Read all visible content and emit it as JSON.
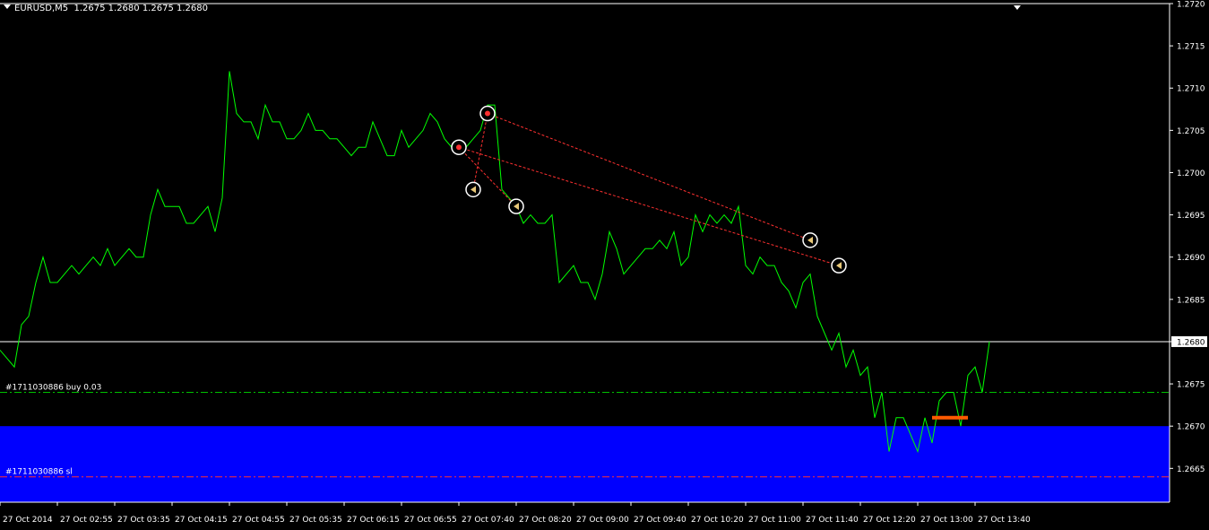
{
  "window": {
    "symbol_timeframe": "EURUSD,M5",
    "ohlc": "1.2675 1.2680 1.2675 1.2680"
  },
  "colors": {
    "background": "#000000",
    "price_line": "#00FF00",
    "grid_frame": "#FFFFFF",
    "buy_line": "#00C000",
    "sl_line": "#FF3030",
    "sl_zone": "#0000FF",
    "trade_arrow": "#FF3030",
    "orange_marker": "#FF5A00"
  },
  "chart_data": {
    "type": "line",
    "title": "EURUSD,M5",
    "ylim": [
      1.2661,
      1.272
    ],
    "y_ticks": [
      "1.2720",
      "1.2715",
      "1.2710",
      "1.2705",
      "1.2700",
      "1.2695",
      "1.2690",
      "1.2685",
      "1.2680",
      "1.2675",
      "1.2670",
      "1.2665"
    ],
    "x_ticks": [
      "27 Oct 2014",
      "27 Oct 02:55",
      "27 Oct 03:35",
      "27 Oct 04:15",
      "27 Oct 04:55",
      "27 Oct 05:35",
      "27 Oct 06:15",
      "27 Oct 06:55",
      "27 Oct 07:40",
      "27 Oct 08:20",
      "27 Oct 09:00",
      "27 Oct 09:40",
      "27 Oct 10:20",
      "27 Oct 11:00",
      "27 Oct 11:40",
      "27 Oct 12:20",
      "27 Oct 13:00",
      "27 Oct 13:40"
    ],
    "bar_minutes": 5,
    "x_tick_bar_index": [
      0,
      8,
      16,
      24,
      32,
      40,
      48,
      56,
      64,
      72,
      80,
      88,
      96,
      104,
      112,
      120,
      128,
      136
    ],
    "series": [
      {
        "values": [
          1.2679,
          1.2678,
          1.2677,
          1.2682,
          1.2683,
          1.2687,
          1.269,
          1.2687,
          1.2687,
          1.2688,
          1.2689,
          1.2688,
          1.2689,
          1.269,
          1.2689,
          1.2691,
          1.2689,
          1.269,
          1.2691,
          1.269,
          1.269,
          1.2695,
          1.2698,
          1.2696,
          1.2696,
          1.2696,
          1.2694,
          1.2694,
          1.2695,
          1.2696,
          1.2693,
          1.2697,
          1.2712,
          1.2707,
          1.2706,
          1.2706,
          1.2704,
          1.2708,
          1.2706,
          1.2706,
          1.2704,
          1.2704,
          1.2705,
          1.2707,
          1.2705,
          1.2705,
          1.2704,
          1.2704,
          1.2703,
          1.2702,
          1.2703,
          1.2703,
          1.2706,
          1.2704,
          1.2702,
          1.2702,
          1.2705,
          1.2703,
          1.2704,
          1.2705,
          1.2707,
          1.2706,
          1.2704,
          1.2703,
          1.2703,
          1.2703,
          1.2704,
          1.2705,
          1.2708,
          1.2708,
          1.2698,
          1.2697,
          1.2696,
          1.2694,
          1.2695,
          1.2694,
          1.2694,
          1.2695,
          1.2687,
          1.2688,
          1.2689,
          1.2687,
          1.2687,
          1.2685,
          1.2688,
          1.2693,
          1.2691,
          1.2688,
          1.2689,
          1.269,
          1.2691,
          1.2691,
          1.2692,
          1.2691,
          1.2693,
          1.2689,
          1.269,
          1.2695,
          1.2693,
          1.2695,
          1.2694,
          1.2695,
          1.2694,
          1.2696,
          1.2689,
          1.2688,
          1.269,
          1.2689,
          1.2689,
          1.2687,
          1.2686,
          1.2684,
          1.2687,
          1.2688,
          1.2683,
          1.2681,
          1.2679,
          1.2681,
          1.2677,
          1.2679,
          1.2676,
          1.2677,
          1.2671,
          1.2674,
          1.2667,
          1.2671,
          1.2671,
          1.2669,
          1.2667,
          1.2671,
          1.2668,
          1.2673,
          1.2674,
          1.2674,
          1.267,
          1.2676,
          1.2677,
          1.2674,
          1.268
        ]
      }
    ],
    "current_price": "1.2680",
    "order_lines": [
      {
        "label": "#1711030886 buy 0.03",
        "price": 1.2674
      },
      {
        "label": "#1711030886 sl",
        "price": 1.2664
      }
    ],
    "sl_zone": {
      "from": 1.2661,
      "to": 1.267
    },
    "orange_marker": {
      "price": 1.2671,
      "bar_from": 130,
      "bar_to": 135
    },
    "trades": [
      {
        "open_bar": 64,
        "open_price": 1.2703,
        "close_bar": 72,
        "close_price": 1.2696
      },
      {
        "open_bar": 64,
        "open_price": 1.2703,
        "close_bar": 117,
        "close_price": 1.2689
      },
      {
        "open_bar": 68,
        "open_price": 1.2707,
        "close_bar": 113,
        "close_price": 1.2692
      },
      {
        "open_bar": 68,
        "open_price": 1.2707,
        "close_bar": 66,
        "close_price": 1.2698
      }
    ]
  }
}
